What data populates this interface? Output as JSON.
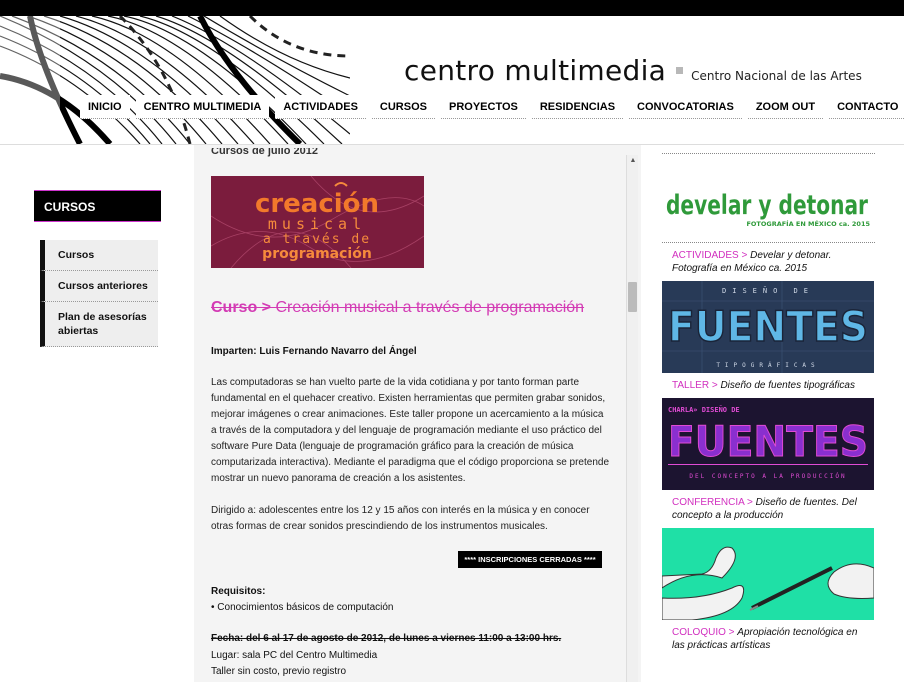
{
  "brand": {
    "title": "centro multimedia",
    "subtitle": "Centro Nacional de las Artes"
  },
  "nav": {
    "items": [
      "INICIO",
      "CENTRO MULTIMEDIA",
      "ACTIVIDADES",
      "CURSOS",
      "PROYECTOS",
      "RESIDENCIAS",
      "CONVOCATORIAS",
      "ZOOM OUT",
      "CONTACTO"
    ]
  },
  "sidebar": {
    "heading": "CURSOS",
    "items": [
      "Cursos",
      "Cursos anteriores",
      "Plan de asesorías abiertas"
    ]
  },
  "main": {
    "cut_text": "Cursos de julio 2012",
    "image": {
      "line1": "creación",
      "line2": "musical",
      "line3": "a través de",
      "line4": "programación"
    },
    "title_prefix": "Curso >",
    "title": "Creación musical a través de programación",
    "teachers": "Imparten: Luis Fernando Navarro del Ángel",
    "paragraph1": "Las computadoras se han vuelto parte de la vida cotidiana y por tanto forman parte fundamental en el quehacer creativo. Existen herramientas que permiten grabar sonidos, mejorar imágenes o crear animaciones. Este taller propone un acercamiento a la música a través de la computadora y del lenguaje de programación mediante el uso práctico del software Pure Data (lenguaje de programación gráfico para la creación de música computarizada interactiva). Mediante el paradigma que el código proporciona se pretende mostrar un nuevo panorama de creación a los asistentes.",
    "paragraph2": "Dirigido a: adolescentes entre los 12 y 15 años con interés en la música y en conocer otras formas de crear sonidos prescindiendo de los instrumentos musicales.",
    "closed_button": "**** INSCRIPCIONES CERRADAS ****",
    "requirements_heading": "Requisitos:",
    "requirements_item": "• Conocimientos básicos de computación",
    "date": "Fecha: del 6 al 17 de agosto de 2012, de lunes a viernes 11:00 a 13:00 hrs.",
    "place": "Lugar: sala PC del Centro Multimedia",
    "cost": "Taller sin costo, previo registro"
  },
  "right": {
    "promo1": {
      "headline": "develar y detonar",
      "tagline": "FOTOGRAFÍA EN MÉXICO ca. 2015",
      "category": "ACTIVIDADES >",
      "text": "Develar y detonar. Fotografía en México ca. 2015"
    },
    "promo2": {
      "top": "DISEÑO DE",
      "big": "FUENTES",
      "bottom": "TIPOGRÁFICAS",
      "category": "TALLER >",
      "text": "Diseño de fuentes tipográficas"
    },
    "promo3": {
      "top": "CHARLA» DISEÑO DE",
      "big": "FUENTES",
      "bottom": "DEL CONCEPTO A LA PRODUCCIÓN",
      "category": "CONFERENCIA >",
      "text": "Diseño de fuentes. Del concepto a la producción"
    },
    "promo4": {
      "category": "COLOQUIO >",
      "text": "Apropiación tecnológica en las prácticas artísticas"
    }
  },
  "colors": {
    "accent": "#d12fbf",
    "nav_bg": "#ffffff",
    "promo_green": "#2f9a3a",
    "promo_teal": "#22e3a8"
  }
}
